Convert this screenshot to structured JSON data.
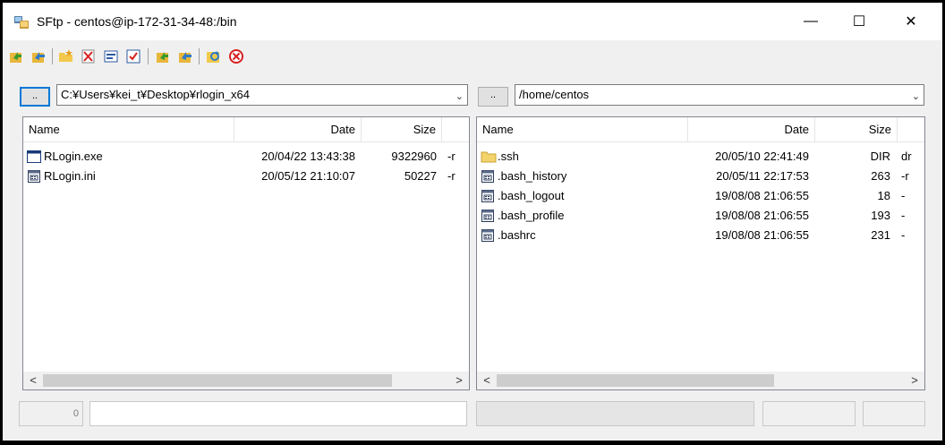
{
  "window": {
    "title": "SFtp - centos@ip-172-31-34-48:/bin",
    "minimize_glyph": "—",
    "maximize_glyph": "☐",
    "close_glyph": "✕"
  },
  "toolbar": {
    "icons": [
      "upload-icon",
      "upload-all-icon",
      "new-folder-icon",
      "delete-icon",
      "rename-icon",
      "attributes-icon",
      "download-icon",
      "download-all-icon",
      "refresh-icon",
      "cancel-icon"
    ]
  },
  "left": {
    "up_button": "..",
    "path": "C:¥Users¥kei_t¥Desktop¥rlogin_x64",
    "columns": [
      "Name",
      "Date",
      "Size"
    ],
    "files": [
      {
        "name": "RLogin.exe",
        "date": "20/04/22 13:43:38",
        "size": "9322960",
        "attr": "-r",
        "icon": "exe-icon"
      },
      {
        "name": "RLogin.ini",
        "date": "20/05/12 21:10:07",
        "size": "50227",
        "attr": "-r",
        "icon": "file-icon"
      }
    ]
  },
  "right": {
    "up_button": "..",
    "path": "/home/centos",
    "columns": [
      "Name",
      "Date",
      "Size"
    ],
    "files": [
      {
        "name": ".ssh",
        "date": "20/05/10 22:41:49",
        "size": "DIR",
        "attr": "dr",
        "icon": "folder-icon"
      },
      {
        "name": ".bash_history",
        "date": "20/05/11 22:17:53",
        "size": "263",
        "attr": "-r",
        "icon": "file-icon"
      },
      {
        "name": ".bash_logout",
        "date": "19/08/08 21:06:55",
        "size": "18",
        "attr": "-",
        "icon": "file-icon"
      },
      {
        "name": ".bash_profile",
        "date": "19/08/08 21:06:55",
        "size": "193",
        "attr": "-",
        "icon": "file-icon"
      },
      {
        "name": ".bashrc",
        "date": "19/08/08 21:06:55",
        "size": "231",
        "attr": "-",
        "icon": "file-icon"
      }
    ]
  },
  "scroll": {
    "left_arrow": "<",
    "right_arrow": ">"
  },
  "status": {
    "left_count": "0"
  }
}
